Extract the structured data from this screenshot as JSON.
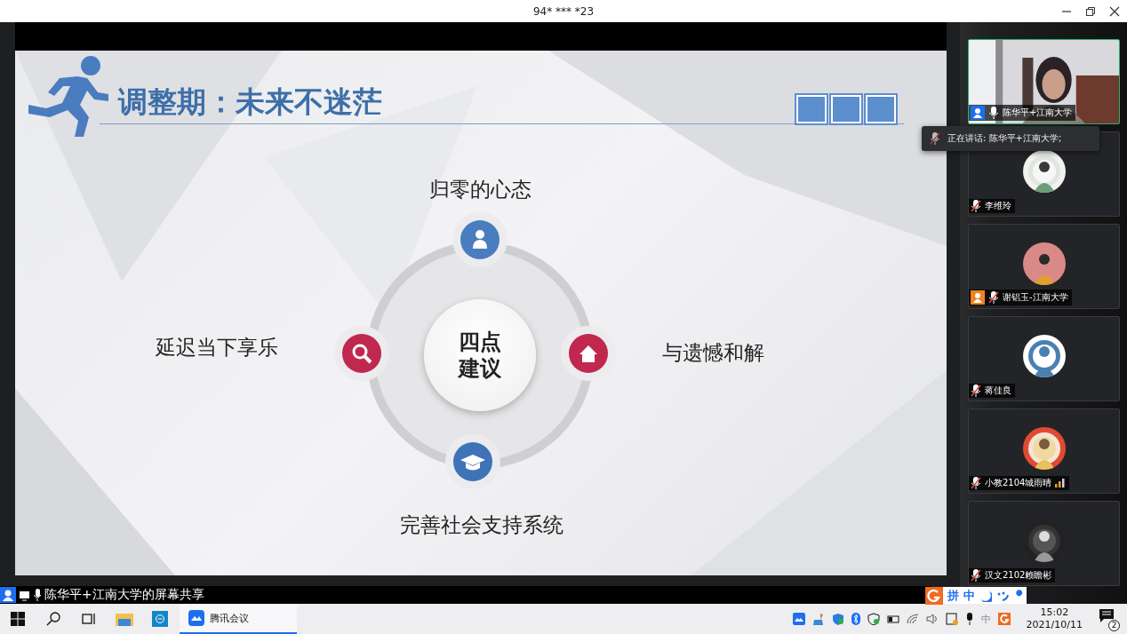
{
  "window": {
    "title": "94* *** *23"
  },
  "slide": {
    "title": "调整期：未来不迷茫",
    "center_lines": [
      "四点",
      "建议"
    ],
    "points": [
      {
        "label": "归零的心态",
        "kind": "person"
      },
      {
        "label": "与遗憾和解",
        "kind": "home"
      },
      {
        "label": "完善社会支持系统",
        "kind": "cap"
      },
      {
        "label": "延迟当下享乐",
        "kind": "search"
      }
    ]
  },
  "share_label": "陈华平+江南大学的屏幕共享",
  "participants": [
    {
      "name": "陈华平+江南大学",
      "kind": "video",
      "selected": true,
      "muted": false,
      "color": "#1e6ff0",
      "volume_shown": false
    },
    {
      "name": "李维玲",
      "kind": "avatar",
      "selected": false,
      "muted": true,
      "volume_shown": false
    },
    {
      "name": "谢铝玉-江南大学",
      "kind": "avatar",
      "selected": false,
      "muted": true,
      "color": "#f0821e",
      "volume_shown": false
    },
    {
      "name": "蒋佳良",
      "kind": "avatar",
      "selected": false,
      "muted": true,
      "volume_shown": false
    },
    {
      "name": "小教2104城雨晴",
      "kind": "avatar",
      "selected": false,
      "muted": true,
      "volume_shown": true
    },
    {
      "name": "汉文2102赖瞻彬",
      "kind": "avatar",
      "selected": false,
      "muted": true,
      "volume_shown": false
    }
  ],
  "tooltip": "正在讲话: 陈华平+江南大学;",
  "ime": {
    "labels": [
      "拼",
      "中"
    ]
  },
  "taskbar": {
    "items": [
      {
        "kind": "start",
        "selected": false
      },
      {
        "kind": "search",
        "selected": false
      },
      {
        "kind": "taskview",
        "selected": false
      },
      {
        "kind": "explorer",
        "selected": false
      },
      {
        "kind": "app",
        "selected": false
      },
      {
        "kind": "meeting",
        "label": "腾讯会议",
        "selected": true
      }
    ],
    "tray_ime": "中",
    "time": "15:02",
    "date": "2021/10/11",
    "notifications": "2"
  }
}
